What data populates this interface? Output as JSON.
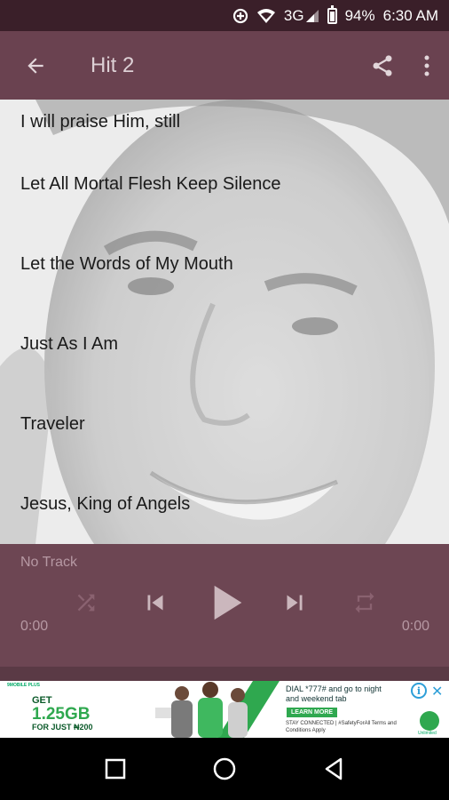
{
  "status_bar": {
    "network": "3G",
    "battery": "94%",
    "time": "6:30 AM",
    "icons": [
      "data-saver-icon",
      "wifi-icon",
      "signal-icon",
      "battery-icon"
    ]
  },
  "toolbar": {
    "title": "Hit 2",
    "icons": [
      "back-arrow-icon",
      "share-icon",
      "more-vert-icon"
    ]
  },
  "songs": [
    "I will praise Him, still",
    "Let All Mortal Flesh Keep Silence",
    "Let the Words of My Mouth",
    "Just As I Am",
    "Traveler",
    "Jesus, King of Angels"
  ],
  "player": {
    "track": "No Track",
    "elapsed": "0:00",
    "duration": "0:00",
    "controls": [
      "shuffle-icon",
      "skip-previous-icon",
      "play-icon",
      "skip-next-icon",
      "repeat-icon"
    ]
  },
  "ad": {
    "brand": "9MOBILE PLUS",
    "get": "GET",
    "data": "1.25GB",
    "price": "FOR JUST ₦200",
    "dial": "DIAL *777# and go to night and weekend tab",
    "cta": "LEARN MORE",
    "footer": "STAY CONNECTED | #SafetyForAll Terms and Conditions Apply",
    "logo_text": "Unlimited"
  },
  "colors": {
    "status_bg": "#3a1f29",
    "toolbar_bg": "#6a4250",
    "player_bg": "#6d4653",
    "accent_green": "#2fa84f"
  }
}
